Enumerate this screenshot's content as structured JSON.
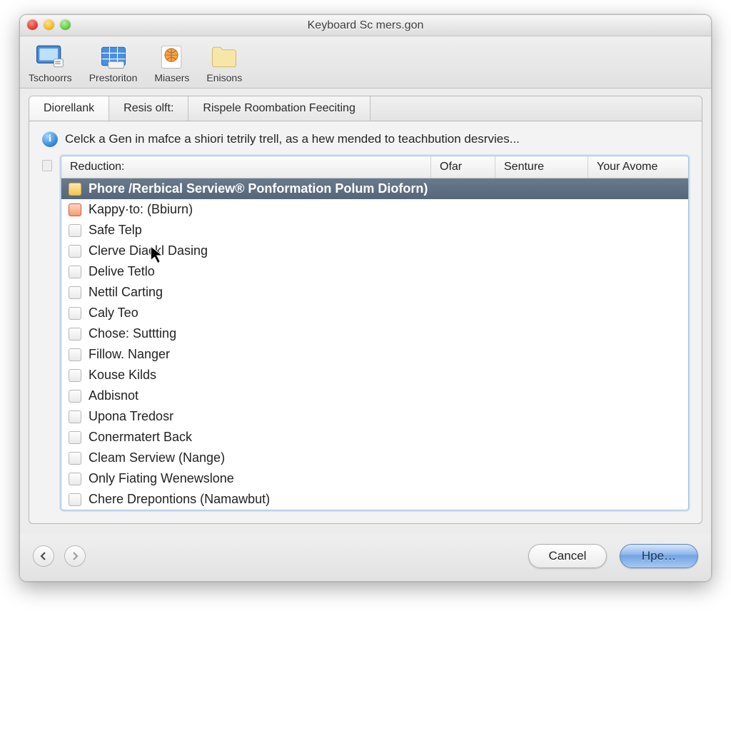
{
  "window": {
    "title": "Keyboard Sc mers.gon"
  },
  "toolbar": [
    {
      "name": "tschoorrs",
      "label": "Tschoorrs",
      "icon": "monitor-icon"
    },
    {
      "name": "prestoriton",
      "label": "Prestoriton",
      "icon": "grid-icon"
    },
    {
      "name": "miasers",
      "label": "Miasers",
      "icon": "globe-doc-icon"
    },
    {
      "name": "enisons",
      "label": "Enisons",
      "icon": "folder-icon"
    }
  ],
  "tabs": [
    {
      "name": "diorellank",
      "label": "Diorellank",
      "active": true
    },
    {
      "name": "resis-olft",
      "label": "Resis olft:",
      "active": false
    },
    {
      "name": "rispele",
      "label": "Rispele Roombation Feeciting",
      "active": false
    }
  ],
  "info_text": "Celck a Gen in mafce a shiori tetrily trell, as a hew mended to teachbution desrvies...",
  "columns": {
    "main": "Reduction:",
    "c2": "Ofar",
    "c3": "Senture",
    "c4": "Your Avome"
  },
  "rows": [
    {
      "label": "Phore /Rerbical Serview® Ponformation Polum Dioforn)",
      "selected": true,
      "icon": "highlight"
    },
    {
      "label": "Kappy·to: (Bbiurn)",
      "icon": "special"
    },
    {
      "label": "Safe Telp"
    },
    {
      "label": "Clerve Diackl Dasing"
    },
    {
      "label": "Delive Tetlo"
    },
    {
      "label": "Nettil Carting"
    },
    {
      "label": "Caly Teo"
    },
    {
      "label": "Chose: Suttting"
    },
    {
      "label": "Fillow. Nanger"
    },
    {
      "label": "Kouse Kilds"
    },
    {
      "label": "Adbisnot"
    },
    {
      "label": "Upona Tredosr"
    },
    {
      "label": "Conermatert Back"
    },
    {
      "label": "Cleam Serview (Nange)"
    },
    {
      "label": "Only Fiating Wenewslone"
    },
    {
      "label": "Chere Drepontions (Namawbut)"
    }
  ],
  "footer": {
    "cancel": "Cancel",
    "primary": "Hpe…"
  }
}
